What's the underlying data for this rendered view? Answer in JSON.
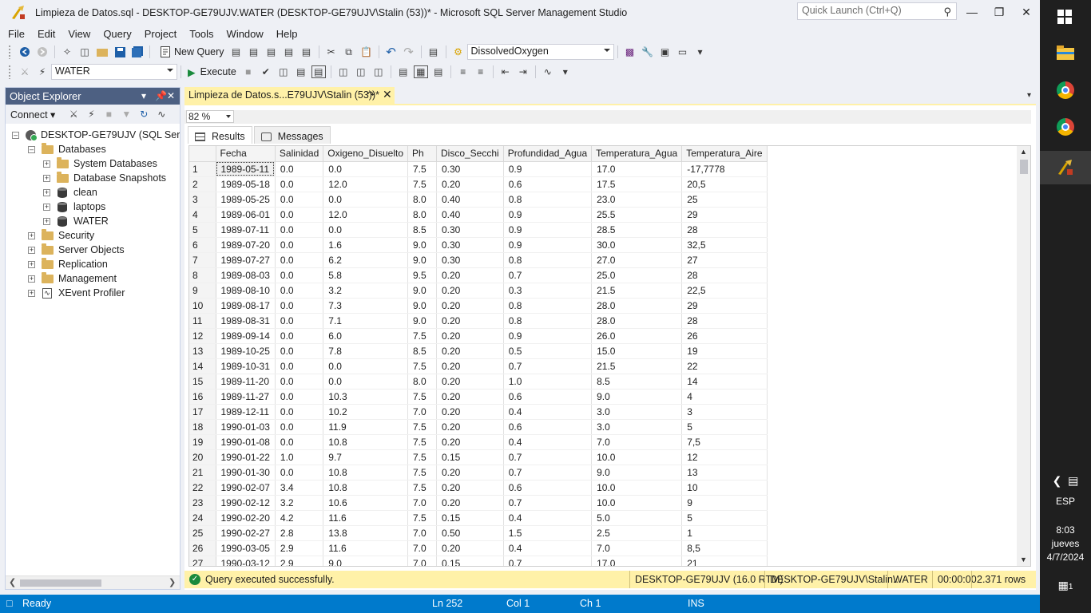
{
  "window": {
    "title": "Limpieza de Datos.sql - DESKTOP-GE79UJV.WATER (DESKTOP-GE79UJV\\Stalin (53))* - Microsoft SQL Server Management Studio",
    "quick_launch_placeholder": "Quick Launch (Ctrl+Q)"
  },
  "menu": [
    "File",
    "Edit",
    "View",
    "Query",
    "Project",
    "Tools",
    "Window",
    "Help"
  ],
  "toolbar": {
    "new_query_label": "New Query",
    "solution_combo": "DissolvedOxygen",
    "database_combo": "WATER",
    "execute_label": "Execute"
  },
  "object_explorer": {
    "title": "Object Explorer",
    "connect_label": "Connect",
    "server": "DESKTOP-GE79UJV (SQL Server 1",
    "databases": "Databases",
    "system_databases": "System Databases",
    "database_snapshots": "Database Snapshots",
    "db_clean": "clean",
    "db_laptops": "laptops",
    "db_water": "WATER",
    "security": "Security",
    "server_objects": "Server Objects",
    "replication": "Replication",
    "management": "Management",
    "xevent_profiler": "XEvent Profiler"
  },
  "document": {
    "tab_label": "Limpieza de Datos.s...E79UJV\\Stalin (53))*",
    "zoom": "82 %",
    "results_tab": "Results",
    "messages_tab": "Messages"
  },
  "grid": {
    "columns": [
      "Fecha",
      "Salinidad",
      "Oxigeno_Disuelto",
      "Ph",
      "Disco_Secchi",
      "Profundidad_Agua",
      "Temperatura_Agua",
      "Temperatura_Aire"
    ],
    "rows": [
      [
        "1",
        "1989-05-11",
        "0.0",
        "0.0",
        "7.5",
        "0.30",
        "0.9",
        "17.0",
        "-17,7778"
      ],
      [
        "2",
        "1989-05-18",
        "0.0",
        "12.0",
        "7.5",
        "0.20",
        "0.6",
        "17.5",
        "20,5"
      ],
      [
        "3",
        "1989-05-25",
        "0.0",
        "0.0",
        "8.0",
        "0.40",
        "0.8",
        "23.0",
        "25"
      ],
      [
        "4",
        "1989-06-01",
        "0.0",
        "12.0",
        "8.0",
        "0.40",
        "0.9",
        "25.5",
        "29"
      ],
      [
        "5",
        "1989-07-11",
        "0.0",
        "0.0",
        "8.5",
        "0.30",
        "0.9",
        "28.5",
        "28"
      ],
      [
        "6",
        "1989-07-20",
        "0.0",
        "1.6",
        "9.0",
        "0.30",
        "0.9",
        "30.0",
        "32,5"
      ],
      [
        "7",
        "1989-07-27",
        "0.0",
        "6.2",
        "9.0",
        "0.30",
        "0.8",
        "27.0",
        "27"
      ],
      [
        "8",
        "1989-08-03",
        "0.0",
        "5.8",
        "9.5",
        "0.20",
        "0.7",
        "25.0",
        "28"
      ],
      [
        "9",
        "1989-08-10",
        "0.0",
        "3.2",
        "9.0",
        "0.20",
        "0.3",
        "21.5",
        "22,5"
      ],
      [
        "10",
        "1989-08-17",
        "0.0",
        "7.3",
        "9.0",
        "0.20",
        "0.8",
        "28.0",
        "29"
      ],
      [
        "11",
        "1989-08-31",
        "0.0",
        "7.1",
        "9.0",
        "0.20",
        "0.8",
        "28.0",
        "28"
      ],
      [
        "12",
        "1989-09-14",
        "0.0",
        "6.0",
        "7.5",
        "0.20",
        "0.9",
        "26.0",
        "26"
      ],
      [
        "13",
        "1989-10-25",
        "0.0",
        "7.8",
        "8.5",
        "0.20",
        "0.5",
        "15.0",
        "19"
      ],
      [
        "14",
        "1989-10-31",
        "0.0",
        "0.0",
        "7.5",
        "0.20",
        "0.7",
        "21.5",
        "22"
      ],
      [
        "15",
        "1989-11-20",
        "0.0",
        "0.0",
        "8.0",
        "0.20",
        "1.0",
        "8.5",
        "14"
      ],
      [
        "16",
        "1989-11-27",
        "0.0",
        "10.3",
        "7.5",
        "0.20",
        "0.6",
        "9.0",
        "4"
      ],
      [
        "17",
        "1989-12-11",
        "0.0",
        "10.2",
        "7.0",
        "0.20",
        "0.4",
        "3.0",
        "3"
      ],
      [
        "18",
        "1990-01-03",
        "0.0",
        "11.9",
        "7.5",
        "0.20",
        "0.6",
        "3.0",
        "5"
      ],
      [
        "19",
        "1990-01-08",
        "0.0",
        "10.8",
        "7.5",
        "0.20",
        "0.4",
        "7.0",
        "7,5"
      ],
      [
        "20",
        "1990-01-22",
        "1.0",
        "9.7",
        "7.5",
        "0.15",
        "0.7",
        "10.0",
        "12"
      ],
      [
        "21",
        "1990-01-30",
        "0.0",
        "10.8",
        "7.5",
        "0.20",
        "0.7",
        "9.0",
        "13"
      ],
      [
        "22",
        "1990-02-07",
        "3.4",
        "10.8",
        "7.5",
        "0.20",
        "0.6",
        "10.0",
        "10"
      ],
      [
        "23",
        "1990-02-12",
        "3.2",
        "10.6",
        "7.0",
        "0.20",
        "0.7",
        "10.0",
        "9"
      ],
      [
        "24",
        "1990-02-20",
        "4.2",
        "11.6",
        "7.5",
        "0.15",
        "0.4",
        "5.0",
        "5"
      ],
      [
        "25",
        "1990-02-27",
        "2.8",
        "13.8",
        "7.0",
        "0.50",
        "1.5",
        "2.5",
        "1"
      ],
      [
        "26",
        "1990-03-05",
        "2.9",
        "11.6",
        "7.0",
        "0.20",
        "0.4",
        "7.0",
        "8,5"
      ],
      [
        "27",
        "1990-03-12",
        "2.9",
        "9.0",
        "7.0",
        "0.15",
        "0.7",
        "17.0",
        "21"
      ]
    ]
  },
  "query_status": {
    "message": "Query executed successfully.",
    "server": "DESKTOP-GE79UJV (16.0 RTM)",
    "user": "DESKTOP-GE79UJV\\Stalin...",
    "database": "WATER",
    "elapsed": "00:00:00",
    "rows": "2.371 rows"
  },
  "statusbar": {
    "ready": "Ready",
    "ln": "Ln 252",
    "col": "Col 1",
    "ch": "Ch 1",
    "mode": "INS"
  },
  "taskbar": {
    "lang": "ESP",
    "time": "8:03",
    "day": "jueves",
    "date": "4/7/2024",
    "notifications": "1"
  },
  "colors": {
    "accent_blue": "#007acc",
    "panel_header": "#4d6082",
    "doc_tab": "#fff1a8"
  }
}
